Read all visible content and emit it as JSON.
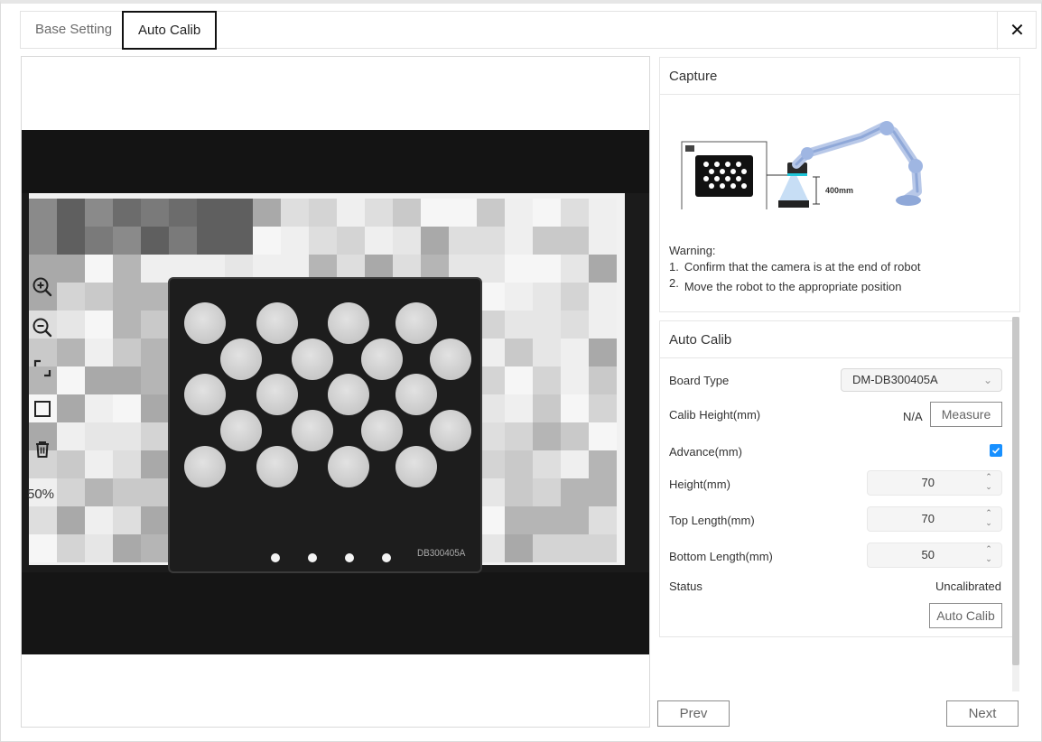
{
  "tabs": [
    {
      "label": "Base Setting",
      "active": false
    },
    {
      "label": "Auto Calib",
      "active": true
    }
  ],
  "close_icon": "close-icon",
  "viewer": {
    "zoom_level": "50%",
    "tools": [
      "zoom-in-icon",
      "zoom-out-icon",
      "fit-screen-icon",
      "rectangle-icon",
      "trash-icon"
    ],
    "board_label": "DB300405A"
  },
  "capture": {
    "title": "Capture",
    "diagram_distance": "400mm",
    "warning_heading": "Warning:",
    "warnings": [
      {
        "num": "1.",
        "text": "Confirm that the camera is at the end of robot"
      },
      {
        "num": "2.",
        "text": "Move the robot to the appropriate position"
      }
    ]
  },
  "auto_calib": {
    "title": "Auto Calib",
    "board_type_label": "Board Type",
    "board_type_value": "DM-DB300405A",
    "calib_height_label": "Calib Height(mm)",
    "calib_height_value": "N/A",
    "measure_button": "Measure",
    "advance_label": "Advance(mm)",
    "advance_checked": true,
    "height_label": "Height(mm)",
    "height_value": "70",
    "top_length_label": "Top Length(mm)",
    "top_length_value": "70",
    "bottom_length_label": "Bottom Length(mm)",
    "bottom_length_value": "50",
    "status_label": "Status",
    "status_value": "Uncalibrated",
    "auto_calib_button": "Auto Calib"
  },
  "nav": {
    "prev": "Prev",
    "next": "Next"
  },
  "colors": {
    "accent": "#1890ff",
    "active_tab_border": "#111111"
  }
}
